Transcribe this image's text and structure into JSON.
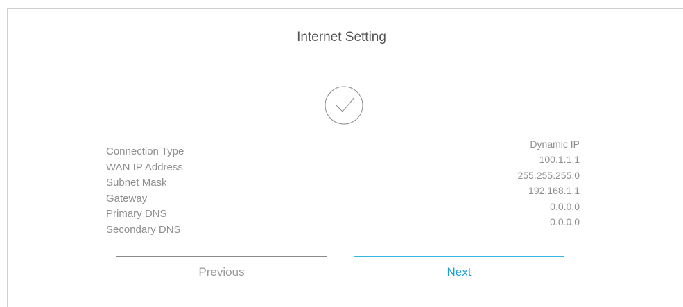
{
  "header": {
    "title": "Internet Setting"
  },
  "status": {
    "icon": "check-circle-icon"
  },
  "summary": {
    "labels": [
      "Connection Type",
      "WAN IP Address",
      "Subnet Mask",
      "Gateway",
      "Primary DNS",
      "Secondary DNS"
    ],
    "values": [
      "Dynamic IP",
      "100.1.1.1",
      "255.255.255.0",
      "192.168.1.1",
      "0.0.0.0",
      "0.0.0.0"
    ]
  },
  "buttons": {
    "previous_label": "Previous",
    "next_label": "Next"
  },
  "colors": {
    "accent": "#35b6e0",
    "text_muted": "#8f8f8f",
    "border": "#cfcfcf"
  }
}
